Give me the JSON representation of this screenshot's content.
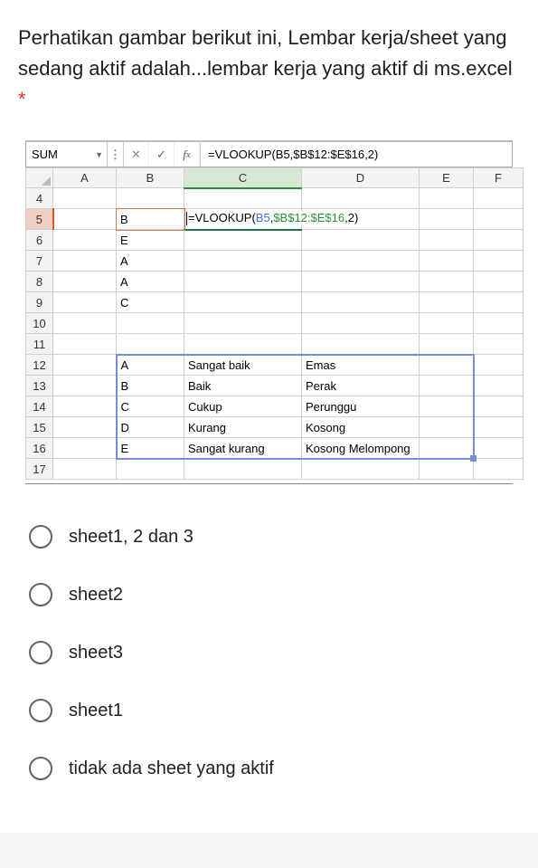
{
  "question": {
    "text": "Perhatikan gambar berikut ini, Lembar kerja/sheet yang sedang aktif adalah...lembar kerja yang aktif di ms.excel",
    "requiredMark": "*"
  },
  "excel": {
    "nameBox": "SUM",
    "formulaBar": "=VLOOKUP(B5,$B$12:$E$16,2)",
    "columns": [
      "A",
      "B",
      "C",
      "D",
      "E",
      "F"
    ],
    "rows": [
      "4",
      "5",
      "6",
      "7",
      "8",
      "9",
      "10",
      "11",
      "12",
      "13",
      "14",
      "15",
      "16",
      "17"
    ],
    "cells": {
      "B5": "B",
      "C5_formula": "=VLOOKUP(",
      "C5_ref1": "B5",
      "C5_mid": ",",
      "C5_ref2": "$B$12:$E$16",
      "C5_end": ",2)",
      "B6": "E",
      "B7": "A",
      "B8": "A",
      "B9": "C",
      "B12": "A",
      "C12": "Sangat baik",
      "D12": "Emas",
      "B13": "B",
      "C13": "Baik",
      "D13": "Perak",
      "B14": "C",
      "C14": "Cukup",
      "D14": "Perunggu",
      "B15": "D",
      "C15": "Kurang",
      "D15": "Kosong",
      "B16": "E",
      "C16": "Sangat kurang",
      "D16": "Kosong Melompong"
    }
  },
  "options": [
    "sheet1, 2 dan 3",
    "sheet2",
    "sheet3",
    "sheet1",
    "tidak ada sheet yang aktif"
  ]
}
